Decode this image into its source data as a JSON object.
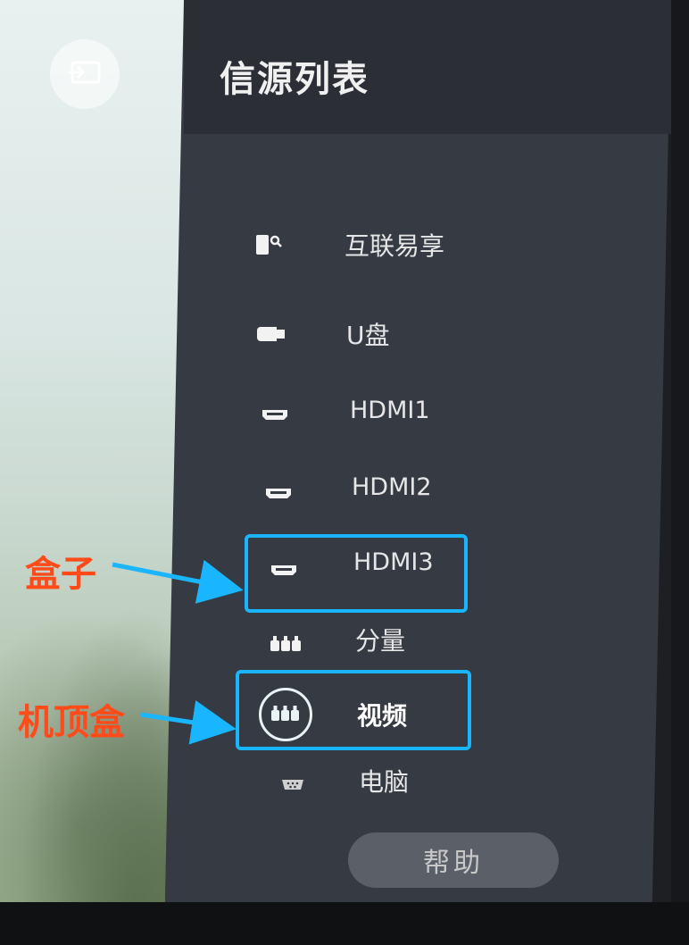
{
  "panel": {
    "title": "信源列表"
  },
  "sources": [
    {
      "label": "互联易享",
      "icon": "screen-share-icon"
    },
    {
      "label": "U盘",
      "icon": "usb-drive-icon"
    },
    {
      "label": "HDMI1",
      "icon": "hdmi-port-icon"
    },
    {
      "label": "HDMI2",
      "icon": "hdmi-port-icon"
    },
    {
      "label": "HDMI3",
      "icon": "hdmi-port-icon"
    },
    {
      "label": "分量",
      "icon": "component-rca-icon"
    },
    {
      "label": "视频",
      "icon": "av-rca-icon",
      "selected": true
    },
    {
      "label": "电脑",
      "icon": "vga-port-icon"
    }
  ],
  "help": {
    "label": "帮助"
  },
  "annotations": {
    "box_label": "盒子",
    "settop_label": "机顶盒",
    "highlight_color": "#19b6ff",
    "text_color": "#ff4a1a"
  },
  "colors": {
    "panel": "#363a42",
    "header": "#2b2e34",
    "selected_ring": "#e8f4f4"
  }
}
